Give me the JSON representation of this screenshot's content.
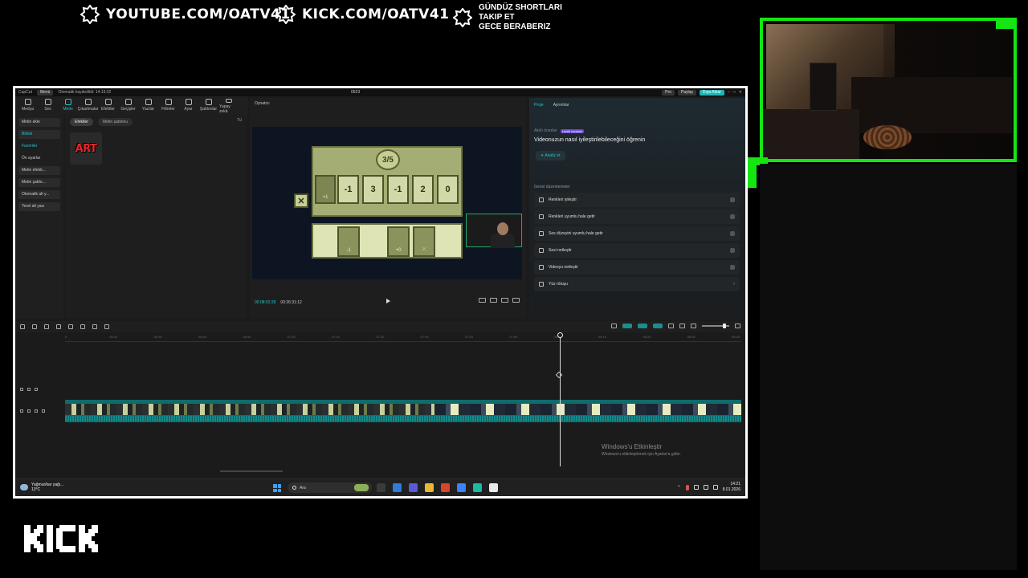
{
  "overlay": {
    "youtube": "YOUTUBE.COM/OATV41",
    "kick": "KICK.COM/OATV41",
    "promo_line1": "GÜNDÜZ SHORTLARI",
    "promo_line2": "TAKIP ET",
    "promo_line3": "GECE BERABERIZ",
    "kick_logo": "KICK",
    "accent_color": "#15e612"
  },
  "window": {
    "app_name": "CapCut",
    "menu": "Menü",
    "autosave": "Otomatik kaydedildi: 14:19:32",
    "title": "0623",
    "pro": "Pro",
    "share": "Paylaş",
    "export": "Dışa Aktar"
  },
  "toolbar": [
    "Medya",
    "Ses",
    "Metin",
    "Çıkartmalar",
    "Efektler",
    "Geçişler",
    "Yazılar",
    "Filtreler",
    "Ayar",
    "Şablonlar",
    "Yapay zekâ"
  ],
  "left_nav": [
    {
      "label": "Metin ekle",
      "style": "box"
    },
    {
      "label": "Bilinki",
      "style": "box-active"
    },
    {
      "label": "Favoriler",
      "style": "active"
    },
    {
      "label": "Ön ayarlar",
      "style": "plain"
    },
    {
      "label": "Metin efekti...",
      "style": "box"
    },
    {
      "label": "Metin şablo...",
      "style": "box"
    },
    {
      "label": "Otomatik alt y...",
      "style": "box"
    },
    {
      "label": "Yerel alt yazı",
      "style": "box"
    }
  ],
  "library": {
    "tab_effects": "Efektler",
    "tab_templates": "Metin şablonu",
    "filter": "Tü",
    "art_label": "ART"
  },
  "player": {
    "title": "Oynatıcı",
    "current_time": "00:08:02:28",
    "total_time": "00:26:31:12",
    "game": {
      "counter": "3/5",
      "lead_card": "+1",
      "cards": [
        "-1",
        "3",
        "-1",
        "2",
        "0"
      ],
      "close": "✕",
      "hand_1": "-1",
      "hand_2": "+0"
    }
  },
  "right_panel": {
    "tab_project": "Proje",
    "tab_details": "Ayrıntılar",
    "ai_sub": "Akıllı öneriler",
    "limited": "Limitli ücretsiz",
    "ai_title": "Videonuzun nasıl iyileştirilebileceğini öğrenin",
    "analyze": "Analiz et",
    "general": "Genel düzenlemeler",
    "options": [
      "Renkleri iyileştir",
      "Renkleri uyumlu hale getir",
      "Ses düzeyini uyumlu hale getir",
      "Sesi netleştir",
      "Videoyu netleştir",
      "Yüz rötuşu"
    ]
  },
  "timeline": {
    "ticks": [
      "0",
      "06:20",
      "06:30",
      "06:40",
      "06:50",
      "07:00",
      "07:10",
      "07:20",
      "07:30",
      "07:40",
      "07:50",
      "08:00",
      "08:10",
      "08:20",
      "08:30",
      "08:40"
    ],
    "win_activate_title": "Windows'u Etkinleştir",
    "win_activate_sub": "Windows'u etkinleştirmek için Ayarlar'a gidin."
  },
  "taskbar": {
    "weather_line1": "Yağmur/kar yağı...",
    "weather_line2": "13°C",
    "search": "Ara",
    "time": "14:21",
    "date": "8.01.2026",
    "app_colors": [
      "#3a3a3a",
      "#2f7bd6",
      "#5a5ad6",
      "#e8b830",
      "#d9452a",
      "#3b83f6",
      "#1db9a0",
      "#e8e8e8"
    ]
  }
}
